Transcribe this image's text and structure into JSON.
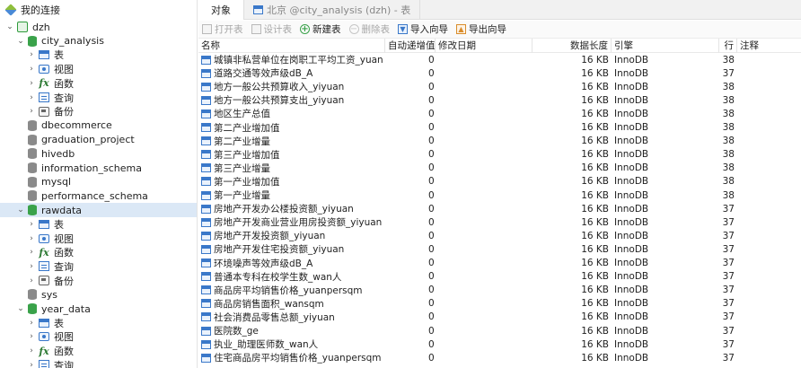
{
  "sidebar": {
    "root_label": "我的连接",
    "items": [
      {
        "label": "dzh",
        "level": 0,
        "expanded": true,
        "icon": "server-icon"
      },
      {
        "label": "city_analysis",
        "level": 1,
        "expanded": true,
        "icon": "database-green-icon"
      },
      {
        "label": "表",
        "level": 2,
        "icon": "table-icon"
      },
      {
        "label": "视图",
        "level": 2,
        "icon": "view-icon"
      },
      {
        "label": "函数",
        "level": 2,
        "icon": "function-icon"
      },
      {
        "label": "查询",
        "level": 2,
        "icon": "query-icon"
      },
      {
        "label": "备份",
        "level": 2,
        "icon": "backup-icon"
      },
      {
        "label": "dbecommerce",
        "level": 1,
        "icon": "database-gray-icon"
      },
      {
        "label": "graduation_project",
        "level": 1,
        "icon": "database-gray-icon"
      },
      {
        "label": "hivedb",
        "level": 1,
        "icon": "database-gray-icon"
      },
      {
        "label": "information_schema",
        "level": 1,
        "icon": "database-gray-icon"
      },
      {
        "label": "mysql",
        "level": 1,
        "icon": "database-gray-icon"
      },
      {
        "label": "performance_schema",
        "level": 1,
        "icon": "database-gray-icon"
      },
      {
        "label": "rawdata",
        "level": 1,
        "expanded": true,
        "icon": "database-green-icon",
        "selected": true
      },
      {
        "label": "表",
        "level": 2,
        "icon": "table-icon"
      },
      {
        "label": "视图",
        "level": 2,
        "icon": "view-icon"
      },
      {
        "label": "函数",
        "level": 2,
        "icon": "function-icon"
      },
      {
        "label": "查询",
        "level": 2,
        "icon": "query-icon"
      },
      {
        "label": "备份",
        "level": 2,
        "icon": "backup-icon"
      },
      {
        "label": "sys",
        "level": 1,
        "icon": "database-gray-icon"
      },
      {
        "label": "year_data",
        "level": 1,
        "expanded": true,
        "icon": "database-green-icon"
      },
      {
        "label": "表",
        "level": 2,
        "icon": "table-icon"
      },
      {
        "label": "视图",
        "level": 2,
        "icon": "view-icon"
      },
      {
        "label": "函数",
        "level": 2,
        "icon": "function-icon"
      },
      {
        "label": "查询",
        "level": 2,
        "icon": "query-icon"
      }
    ]
  },
  "tabs": [
    {
      "label": "对象",
      "active": true
    },
    {
      "label": "北京 @city_analysis (dzh) - 表",
      "active": false
    }
  ],
  "toolbar": {
    "open_table": "打开表",
    "design_table": "设计表",
    "new_table": "新建表",
    "delete_table": "删除表",
    "import_wizard": "导入向导",
    "export_wizard": "导出向导"
  },
  "columns": {
    "name": "名称",
    "auto_increment": "自动递增值",
    "modified_date": "修改日期",
    "data_length": "数据长度",
    "engine": "引擎",
    "rows": "行",
    "comment": "注释"
  },
  "rows": [
    {
      "name": "城镇非私营单位在岗职工平均工资_yuan",
      "auto": "0",
      "size": "16 KB",
      "engine": "InnoDB",
      "rows": "38"
    },
    {
      "name": "道路交通等效声级dB_A",
      "auto": "0",
      "size": "16 KB",
      "engine": "InnoDB",
      "rows": "37"
    },
    {
      "name": "地方一般公共预算收入_yiyuan",
      "auto": "0",
      "size": "16 KB",
      "engine": "InnoDB",
      "rows": "38"
    },
    {
      "name": "地方一般公共预算支出_yiyuan",
      "auto": "0",
      "size": "16 KB",
      "engine": "InnoDB",
      "rows": "38"
    },
    {
      "name": "地区生产总值",
      "auto": "0",
      "size": "16 KB",
      "engine": "InnoDB",
      "rows": "38"
    },
    {
      "name": "第二产业增加值",
      "auto": "0",
      "size": "16 KB",
      "engine": "InnoDB",
      "rows": "38"
    },
    {
      "name": "第二产业增量",
      "auto": "0",
      "size": "16 KB",
      "engine": "InnoDB",
      "rows": "38"
    },
    {
      "name": "第三产业增加值",
      "auto": "0",
      "size": "16 KB",
      "engine": "InnoDB",
      "rows": "38"
    },
    {
      "name": "第三产业增量",
      "auto": "0",
      "size": "16 KB",
      "engine": "InnoDB",
      "rows": "38"
    },
    {
      "name": "第一产业增加值",
      "auto": "0",
      "size": "16 KB",
      "engine": "InnoDB",
      "rows": "38"
    },
    {
      "name": "第一产业增量",
      "auto": "0",
      "size": "16 KB",
      "engine": "InnoDB",
      "rows": "38"
    },
    {
      "name": "房地产开发办公楼投资额_yiyuan",
      "auto": "0",
      "size": "16 KB",
      "engine": "InnoDB",
      "rows": "37"
    },
    {
      "name": "房地产开发商业营业用房投资额_yiyuan",
      "auto": "0",
      "size": "16 KB",
      "engine": "InnoDB",
      "rows": "37"
    },
    {
      "name": "房地产开发投资额_yiyuan",
      "auto": "0",
      "size": "16 KB",
      "engine": "InnoDB",
      "rows": "37"
    },
    {
      "name": "房地产开发住宅投资额_yiyuan",
      "auto": "0",
      "size": "16 KB",
      "engine": "InnoDB",
      "rows": "37"
    },
    {
      "name": "环境噪声等效声级dB_A",
      "auto": "0",
      "size": "16 KB",
      "engine": "InnoDB",
      "rows": "37"
    },
    {
      "name": "普通本专科在校学生数_wan人",
      "auto": "0",
      "size": "16 KB",
      "engine": "InnoDB",
      "rows": "37"
    },
    {
      "name": "商品房平均销售价格_yuanpersqm",
      "auto": "0",
      "size": "16 KB",
      "engine": "InnoDB",
      "rows": "37"
    },
    {
      "name": "商品房销售面积_wansqm",
      "auto": "0",
      "size": "16 KB",
      "engine": "InnoDB",
      "rows": "37"
    },
    {
      "name": "社会消费品零售总额_yiyuan",
      "auto": "0",
      "size": "16 KB",
      "engine": "InnoDB",
      "rows": "37"
    },
    {
      "name": "医院数_ge",
      "auto": "0",
      "size": "16 KB",
      "engine": "InnoDB",
      "rows": "37"
    },
    {
      "name": "执业_助理医师数_wan人",
      "auto": "0",
      "size": "16 KB",
      "engine": "InnoDB",
      "rows": "37"
    },
    {
      "name": "住宅商品房平均销售价格_yuanpersqm",
      "auto": "0",
      "size": "16 KB",
      "engine": "InnoDB",
      "rows": "37"
    }
  ]
}
